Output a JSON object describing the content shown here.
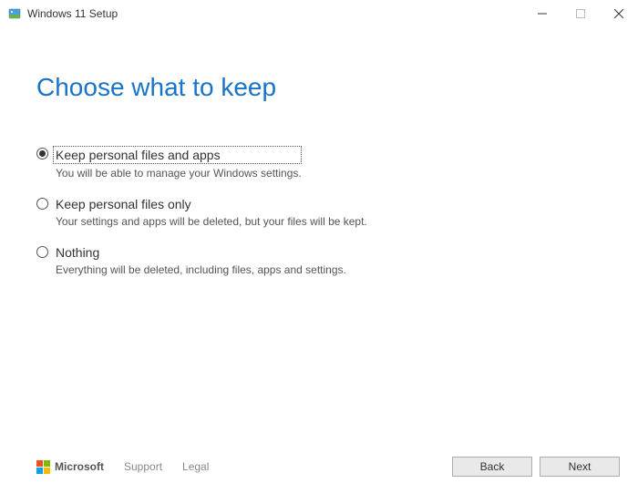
{
  "window": {
    "title": "Windows 11 Setup"
  },
  "heading": "Choose what to keep",
  "options": [
    {
      "label": "Keep personal files and apps",
      "desc": "You will be able to manage your Windows settings.",
      "selected": true
    },
    {
      "label": "Keep personal files only",
      "desc": "Your settings and apps will be deleted, but your files will be kept.",
      "selected": false
    },
    {
      "label": "Nothing",
      "desc": "Everything will be deleted, including files, apps and settings.",
      "selected": false
    }
  ],
  "footer": {
    "brand": "Microsoft",
    "support": "Support",
    "legal": "Legal",
    "back": "Back",
    "next": "Next"
  }
}
